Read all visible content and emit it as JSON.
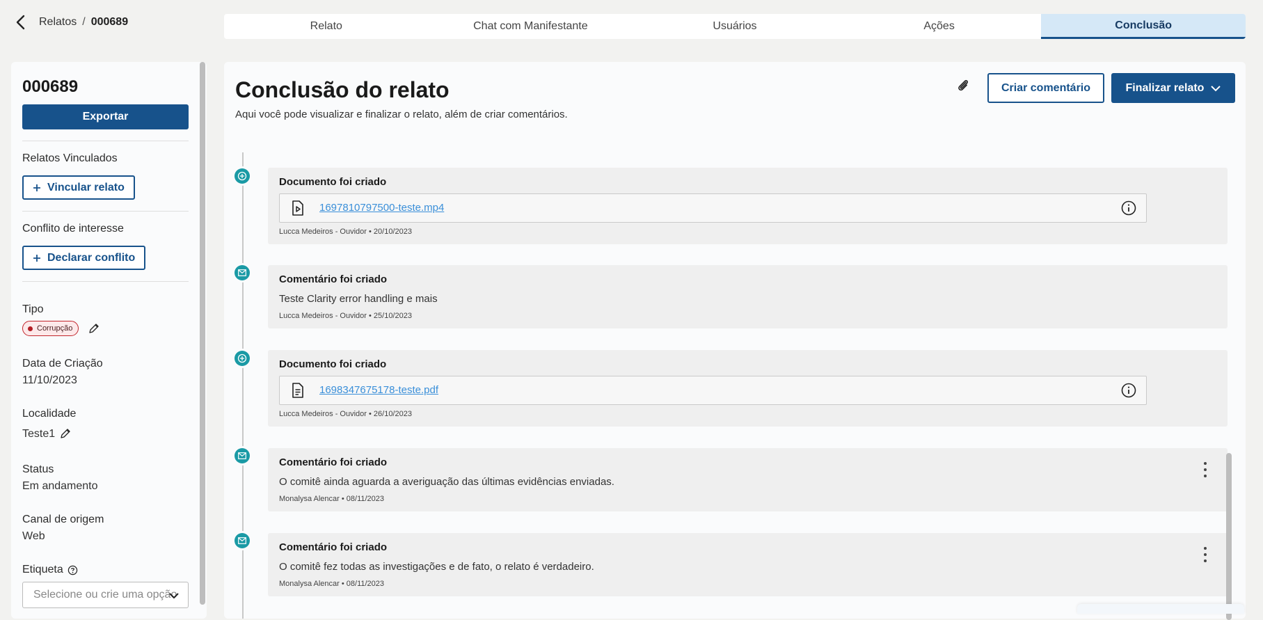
{
  "header": {
    "breadcrumb_root": "Relatos",
    "breadcrumb_sep": "/",
    "breadcrumb_current": "000689",
    "tabs": [
      {
        "label": "Relato"
      },
      {
        "label": "Chat com Manifestante"
      },
      {
        "label": "Usuários"
      },
      {
        "label": "Ações"
      },
      {
        "label": "Conclusão"
      }
    ],
    "active_tab": "Conclusão"
  },
  "sidebar": {
    "id": "000689",
    "export_label": "Exportar",
    "linked_label": "Relatos Vinculados",
    "link_button": "Vincular relato",
    "conflict_label": "Conflito de interesse",
    "conflict_button": "Declarar conflito",
    "type_label": "Tipo",
    "type_value": "Corrupção",
    "created_label": "Data de Criação",
    "created_value": "11/10/2023",
    "location_label": "Localidade",
    "location_value": "Teste1",
    "status_label": "Status",
    "status_value": "Em andamento",
    "channel_label": "Canal de origem",
    "channel_value": "Web",
    "tag_label": "Etiqueta",
    "tag_placeholder": "Selecione ou crie uma opção"
  },
  "main": {
    "title": "Conclusão do relato",
    "subtitle": "Aqui você pode visualizar e finalizar o relato, além de criar comentários.",
    "comment_button": "Criar comentário",
    "finalize_button": "Finalizar relato",
    "timeline": [
      {
        "kind": "document",
        "icon": "plus-circle-icon",
        "title": "Documento foi criado",
        "file": "1697810797500-teste.mp4",
        "file_icon": "video-file-icon",
        "meta": "Lucca Medeiros - Ouvidor • 20/10/2023"
      },
      {
        "kind": "comment",
        "icon": "mail-icon",
        "title": "Comentário foi criado",
        "text": "Teste Clarity error handling e mais",
        "meta": "Lucca Medeiros - Ouvidor • 25/10/2023"
      },
      {
        "kind": "document",
        "icon": "plus-circle-icon",
        "title": "Documento foi criado",
        "file": "1698347675178-teste.pdf",
        "file_icon": "document-file-icon",
        "meta": "Lucca Medeiros - Ouvidor • 26/10/2023"
      },
      {
        "kind": "comment",
        "icon": "mail-icon",
        "title": "Comentário foi criado",
        "text": "O comitê ainda aguarda a averiguação das últimas evidências enviadas.",
        "meta": "Monalysa Alencar • 08/11/2023"
      },
      {
        "kind": "comment",
        "icon": "mail-icon",
        "title": "Comentário foi criado",
        "text": "O comitê fez todas as investigações e de fato, o relato é verdadeiro.",
        "meta": "Monalysa Alencar • 08/11/2023"
      }
    ]
  },
  "colors": {
    "primary": "#17528b",
    "teal": "#1a9aa5",
    "link": "#3a8fd9",
    "badge_red": "#c2252c",
    "active_tab_bg": "#d5e8f7"
  }
}
